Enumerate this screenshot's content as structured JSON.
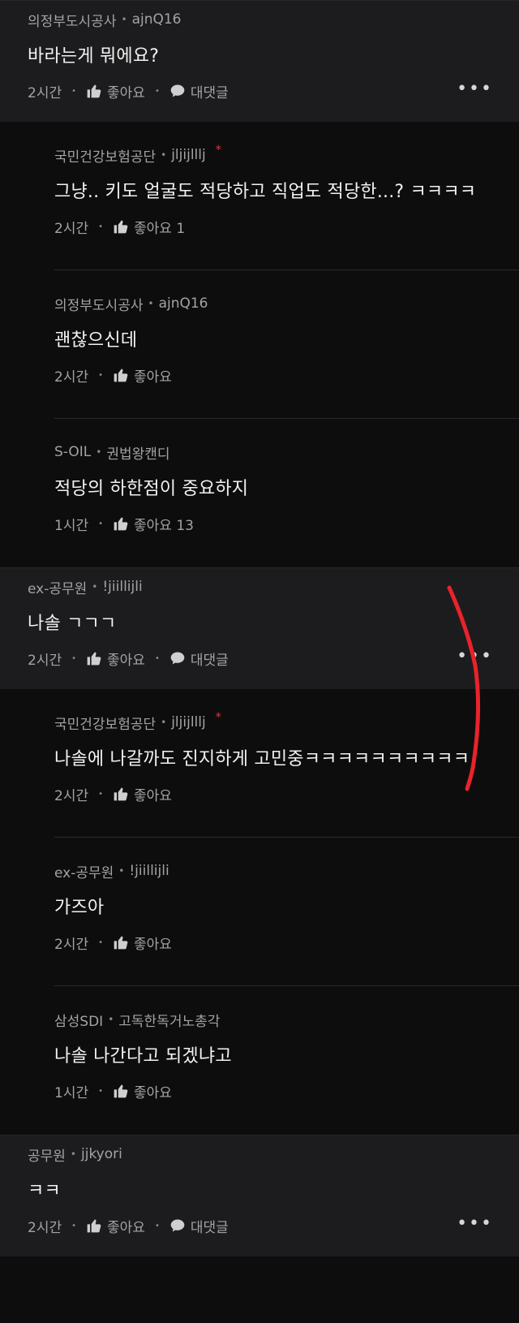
{
  "threads": [
    {
      "parent": {
        "company": "의정부도시공사",
        "user": "ajnQ16",
        "text": "바라는게 뭐에요?",
        "time": "2시간",
        "like_label": "좋아요",
        "reply_label": "대댓글"
      },
      "replies": [
        {
          "company": "국민건강보험공단",
          "user": "jljijlllj",
          "star": "*",
          "text": "그냥.. 키도 얼굴도 적당하고 직업도 적당한...? ㅋㅋㅋㅋ",
          "time": "2시간",
          "like_label": "좋아요 1"
        },
        {
          "company": "의정부도시공사",
          "user": "ajnQ16",
          "star": "",
          "text": "괜찮으신데",
          "time": "2시간",
          "like_label": "좋아요"
        },
        {
          "company": "S-OIL",
          "user": "권법왕캔디",
          "star": "",
          "text": "적당의 하한점이 중요하지",
          "time": "1시간",
          "like_label": "좋아요 13"
        }
      ]
    },
    {
      "parent": {
        "company": "ex-공무원",
        "user": "!jiillijli",
        "text": "나솔 ㄱㄱㄱ",
        "time": "2시간",
        "like_label": "좋아요",
        "reply_label": "대댓글"
      },
      "replies": [
        {
          "company": "국민건강보험공단",
          "user": "jljijlllj",
          "star": "*",
          "text": "나솔에 나갈까도 진지하게 고민중ㅋㅋㅋㅋㅋㅋㅋㅋㅋㅋ",
          "time": "2시간",
          "like_label": "좋아요"
        },
        {
          "company": "ex-공무원",
          "user": "!jiillijli",
          "star": "",
          "text": "가즈아",
          "time": "2시간",
          "like_label": "좋아요"
        },
        {
          "company": "삼성SDI",
          "user": "고독한독거노총각",
          "star": "",
          "text": "나솔 나간다고 되겠냐고",
          "time": "1시간",
          "like_label": "좋아요"
        }
      ]
    },
    {
      "parent": {
        "company": "공무원",
        "user": "jjkyori",
        "text": "ㅋㅋ",
        "time": "2시간",
        "like_label": "좋아요",
        "reply_label": "대댓글"
      },
      "replies": []
    }
  ],
  "separator": "•",
  "more_label": "•••",
  "colors": {
    "annotation": "#e8232a",
    "background": "#0d0d0d",
    "parent_bg": "#1c1c1e"
  }
}
